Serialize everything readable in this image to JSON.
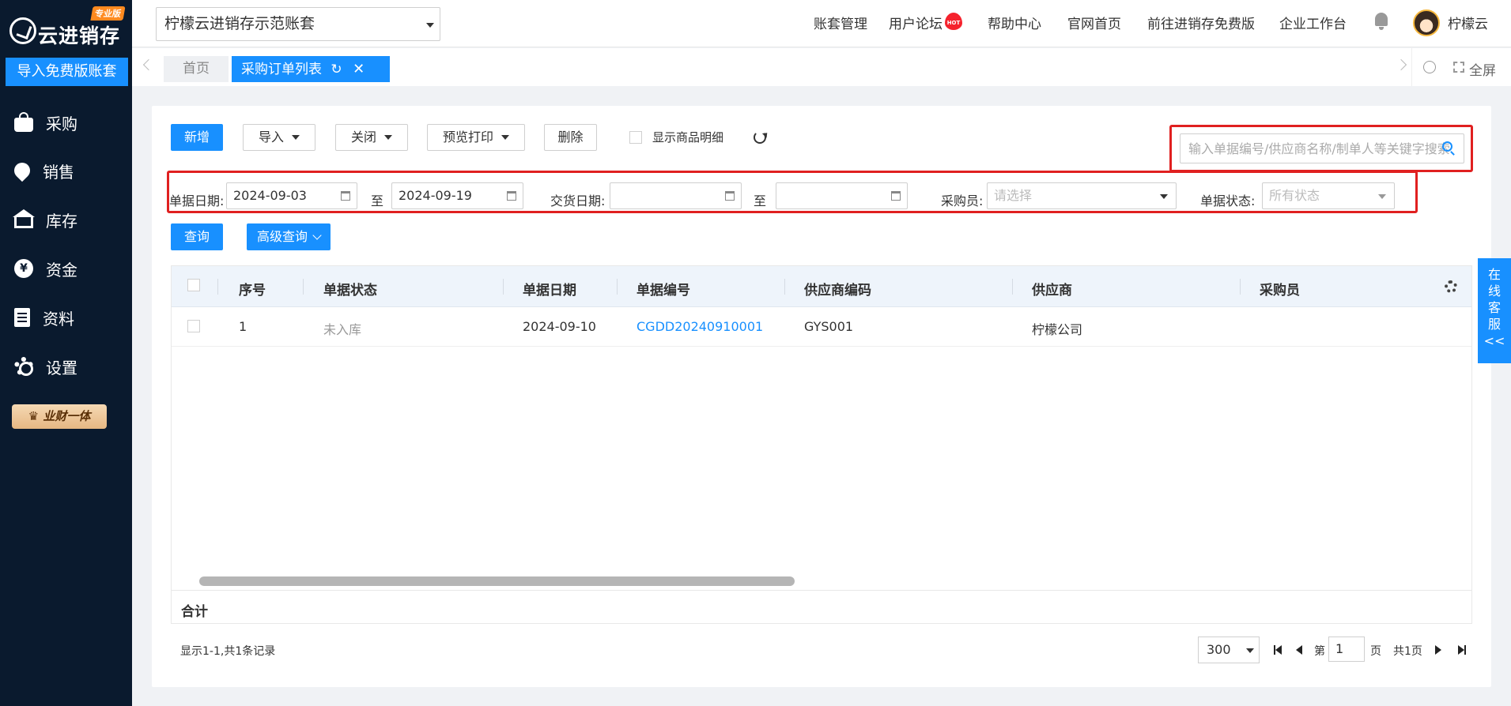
{
  "sidebar": {
    "logo_text": "云进销存",
    "logo_badge": "专业版",
    "import_button": "导入免费版账套",
    "items": [
      {
        "label": "采购",
        "icon": "bag-icon"
      },
      {
        "label": "销售",
        "icon": "sale-icon"
      },
      {
        "label": "库存",
        "icon": "warehouse-icon"
      },
      {
        "label": "资金",
        "icon": "yen-icon"
      },
      {
        "label": "资料",
        "icon": "document-icon"
      },
      {
        "label": "设置",
        "icon": "gear-icon"
      }
    ],
    "promo": "业财一体"
  },
  "header": {
    "account": "柠檬云进销存示范账套",
    "links": [
      "账套管理",
      "用户论坛",
      "帮助中心",
      "官网首页",
      "前往进销存免费版",
      "企业工作台"
    ],
    "hot_badge": "HOT",
    "username": "柠檬云"
  },
  "tabs": {
    "home": "首页",
    "active": "采购订单列表",
    "fullscreen": "全屏"
  },
  "toolbar": {
    "new": "新增",
    "import": "导入",
    "close": "关闭",
    "print": "预览打印",
    "delete": "删除",
    "show_details": "显示商品明细",
    "search_placeholder": "输入单据编号/供应商名称/制单人等关键字搜索"
  },
  "filters": {
    "doc_date_label": "单据日期:",
    "doc_date_from": "2024-09-03",
    "to": "至",
    "doc_date_to": "2024-09-19",
    "delivery_date_label": "交货日期:",
    "buyer_label": "采购员:",
    "buyer_placeholder": "请选择",
    "status_label": "单据状态:",
    "status_placeholder": "所有状态",
    "query": "查询",
    "advanced": "高级查询"
  },
  "table": {
    "columns": [
      "序号",
      "单据状态",
      "单据日期",
      "单据编号",
      "供应商编码",
      "供应商",
      "采购员"
    ],
    "rows": [
      {
        "index": "1",
        "status": "未入库",
        "date": "2024-09-10",
        "number": "CGDD20240910001",
        "supplier_code": "GYS001",
        "supplier": "柠檬公司",
        "buyer": ""
      }
    ],
    "total_label": "合计"
  },
  "pagination": {
    "records": "显示1-1,共1条记录",
    "page_size": "300",
    "page_prefix": "第",
    "page": "1",
    "page_suffix": "页",
    "total_pages": "共1页"
  },
  "customer_service": [
    "在",
    "线",
    "客",
    "服",
    "<<"
  ],
  "colors": {
    "primary": "#1890ff",
    "sidebar": "#0a1a2e",
    "highlight": "#e02020"
  }
}
